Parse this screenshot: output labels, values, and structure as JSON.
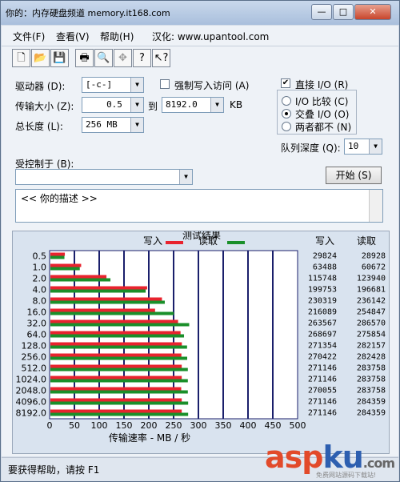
{
  "window": {
    "title": "你的：内存硬盘频道 memory.it168.com"
  },
  "title_buttons": {
    "minimize": "—",
    "maximize": "□",
    "close": "✕"
  },
  "menu": [
    "文件(F)",
    "查看(V)",
    "帮助(H)",
    "汉化: www.upantool.com"
  ],
  "toolbar_icons": [
    "new-file-icon",
    "open-folder-icon",
    "save-icon",
    "print-icon",
    "print-preview-icon",
    "move-icon",
    "help-icon",
    "context-help-icon"
  ],
  "settings": {
    "drive_label": "驱动器 (D):",
    "drive_value": "[-c-]",
    "transfer_label": "传输大小 (Z):",
    "transfer_from": "0.5",
    "to_label": "到",
    "transfer_to": "8192.0",
    "kb_label": "KB",
    "total_label": "总长度 (L):",
    "total_value": "256 MB",
    "force_write_label": "强制写入访问 (A)",
    "force_write_checked": false,
    "direct_io_label": "直接 I/O (R)",
    "direct_io_checked": true,
    "io_compare_label": "I/O 比较 (C)",
    "overlap_io_label": "交叠 I/O (O)",
    "neither_label": "两者都不 (N)",
    "selected_mode": "overlap",
    "queue_label": "队列深度 (Q):",
    "queue_value": "10",
    "controlled_label": "受控制于 (B):",
    "controlled_value": "",
    "start_label": "开始 (S)",
    "description": "<<  你的描述  >>"
  },
  "results": {
    "title": "测试结果",
    "write_legend": "写入",
    "read_legend": "读取",
    "write_header": "写入",
    "read_header": "读取",
    "xlabel": "传输速率 - MB / 秒"
  },
  "chart_data": {
    "type": "bar",
    "categories": [
      "0.5",
      "1.0",
      "2.0",
      "4.0",
      "8.0",
      "16.0",
      "32.0",
      "64.0",
      "128.0",
      "256.0",
      "512.0",
      "1024.0",
      "2048.0",
      "4096.0",
      "8192.0"
    ],
    "series": [
      {
        "name": "写入",
        "color": "#e8232e",
        "values_kbps": [
          29824,
          63488,
          115748,
          199753,
          230319,
          216089,
          263567,
          268697,
          271354,
          270422,
          271146,
          271146,
          270055,
          271146,
          271146
        ]
      },
      {
        "name": "读取",
        "color": "#1a8f2a",
        "values_kbps": [
          28928,
          60672,
          123940,
          196681,
          236142,
          254847,
          286570,
          275854,
          282157,
          282428,
          283758,
          283758,
          283758,
          284359,
          284359
        ]
      }
    ],
    "xticks": [
      "0",
      "50",
      "100",
      "150",
      "200",
      "250",
      "300",
      "350",
      "400",
      "450",
      "500"
    ],
    "xlim": [
      0,
      500
    ]
  },
  "status": {
    "text": "要获得帮助，请按 F1"
  },
  "watermark": {
    "main_a": "asp",
    "main_b": "ku",
    "suffix": ".com",
    "sub": "免费网站源码下载站!"
  }
}
